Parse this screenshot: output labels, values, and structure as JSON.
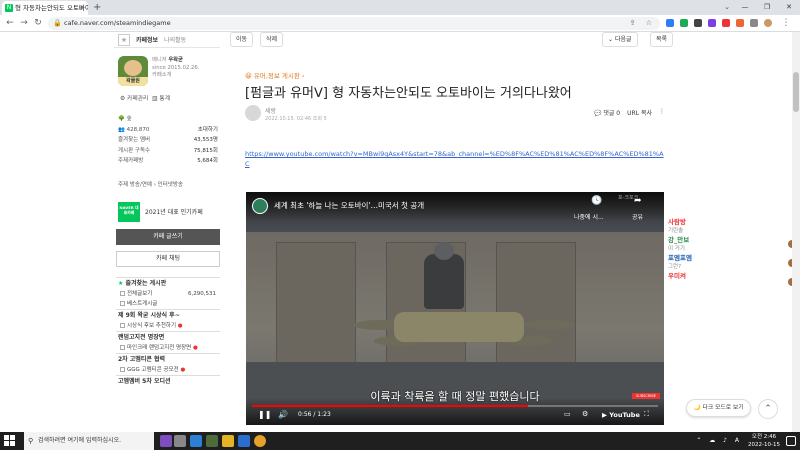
{
  "browser": {
    "tab_title": "형 자동차는안되도 오토바이...",
    "new_tab": "+",
    "url": "cafe.naver.com/steamindiegame",
    "window_buttons": [
      "—",
      "❐",
      "✕"
    ],
    "tab_search": "⌄"
  },
  "sidebar": {
    "tabs": [
      "카페정보",
      "나의활동"
    ],
    "manager_label": "매니저",
    "manager_name": "우왁굳",
    "since": "since 2015.02.26.",
    "cafe_intro": "카페소개",
    "manage_links": [
      "카페관리",
      "통계"
    ],
    "level": "숲",
    "members": "428,870",
    "invite": "초대하기",
    "stats": [
      {
        "label": "즐겨찾는 멤버",
        "value": "43,553명"
      },
      {
        "label": "게시판 구독수",
        "value": "75,815회"
      },
      {
        "label": "주제카페방",
        "value": "5,684회"
      }
    ],
    "topic_links": "주제 방송/연예 › 인터넷방송",
    "naver_badge": "NAVER 대표카페",
    "naver_text": "2021년 대표 인기카페",
    "write_button": "카페 글쓰기",
    "chat_button": "카페 채팅",
    "boards": [
      {
        "type": "head",
        "label": "즐겨찾는 게시판",
        "count": ""
      },
      {
        "type": "item",
        "label": "전체글보기",
        "count": "6,290,531"
      },
      {
        "type": "item",
        "label": "베스트게시글",
        "count": ""
      },
      {
        "type": "head",
        "label": "제 9회 왁굳 시상식 후~",
        "count": ""
      },
      {
        "type": "item",
        "label": "시상식 후보 추천하기",
        "count": ""
      },
      {
        "type": "head",
        "label": "랜덤고지전 명장면",
        "count": ""
      },
      {
        "type": "item",
        "label": "마인크래 랜덤고지전 명장면",
        "count": ""
      },
      {
        "type": "head",
        "label": "2차 고멤티콘 협력",
        "count": ""
      },
      {
        "type": "item",
        "label": "GGG 고멤티콘 공모전",
        "count": ""
      },
      {
        "type": "head",
        "label": "고멤멤버 5차 오디션",
        "count": ""
      }
    ]
  },
  "main": {
    "actions": {
      "move": "이동",
      "delete": "삭제",
      "next": "다음글",
      "list": "목록"
    },
    "board_crumb": "유머,정보 게시판 ›",
    "title": "[펌글과 유머ᐯ] 형 자동차는안되도 오토바이는 거의다나왔어",
    "author_name": "세랑",
    "post_date": "2022.10.15. 02:46  조회 5",
    "tools": {
      "comments": "💬 댓글 0",
      "url_copy": "URL 복사",
      "more": "⋮"
    },
    "link": "https://www.youtube.com/watch?v=MBwi9gAsx4Y&start=78&ab_channel=%ED%8F%AC%ED%81%AC%ED%8F%AC%ED%81%AC"
  },
  "video": {
    "title": "세계 최초 '하늘 나는 오토바이'…미국서 첫 공개",
    "watch_later": "나중에 시...",
    "share": "공유",
    "watermark": "포-크포크",
    "subtitle": "이륙과 착륙을 할 때 정말 편했습니다",
    "time": "0:56 / 1:23",
    "progress": 0.68,
    "brand": "▶ YouTube",
    "ad_badge": "SUBSCRIBE"
  },
  "right_chat": [
    {
      "name": "사람방",
      "sub": "기린솔",
      "color": "#e33"
    },
    {
      "name": "강_만보",
      "sub": "이 거기",
      "color": "#2a8a4a"
    },
    {
      "name": "포엠포엠",
      "sub": "그런?",
      "color": "#1a5fb4"
    },
    {
      "name": "우미켜",
      "sub": "",
      "color": "#e33"
    }
  ],
  "floating": {
    "dark_mode": "🌙 다크 모드로 보기",
    "top": "⌃"
  },
  "taskbar": {
    "search_placeholder": "검색하려면 여기에 입력하십시오.",
    "time": "오전 2:46",
    "date": "2022-10-15",
    "tray_icons": "⌃ ☁ ♪ A"
  }
}
